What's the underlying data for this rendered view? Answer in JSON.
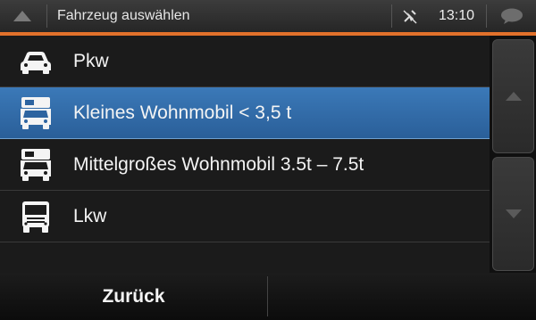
{
  "header": {
    "title": "Fahrzeug auswählen",
    "clock": "13:10",
    "back_icon": "triangle-up-icon",
    "gps_icon": "satellite-icon",
    "message_icon": "speech-bubble-icon",
    "accent_color": "#e2712b"
  },
  "list": {
    "items": [
      {
        "label": "Pkw",
        "icon": "car-icon",
        "selected": false
      },
      {
        "label": "Kleines Wohnmobil < 3,5 t",
        "icon": "camper-icon",
        "selected": true
      },
      {
        "label": "Mittelgroßes Wohnmobil 3.5t – 7.5t",
        "icon": "camper-icon",
        "selected": false
      },
      {
        "label": "Lkw",
        "icon": "truck-icon",
        "selected": false
      }
    ],
    "selected_color": "#3b79b8"
  },
  "scroll": {
    "up_icon": "scroll-up-icon",
    "down_icon": "scroll-down-icon"
  },
  "footer": {
    "back_label": "Zurück"
  }
}
